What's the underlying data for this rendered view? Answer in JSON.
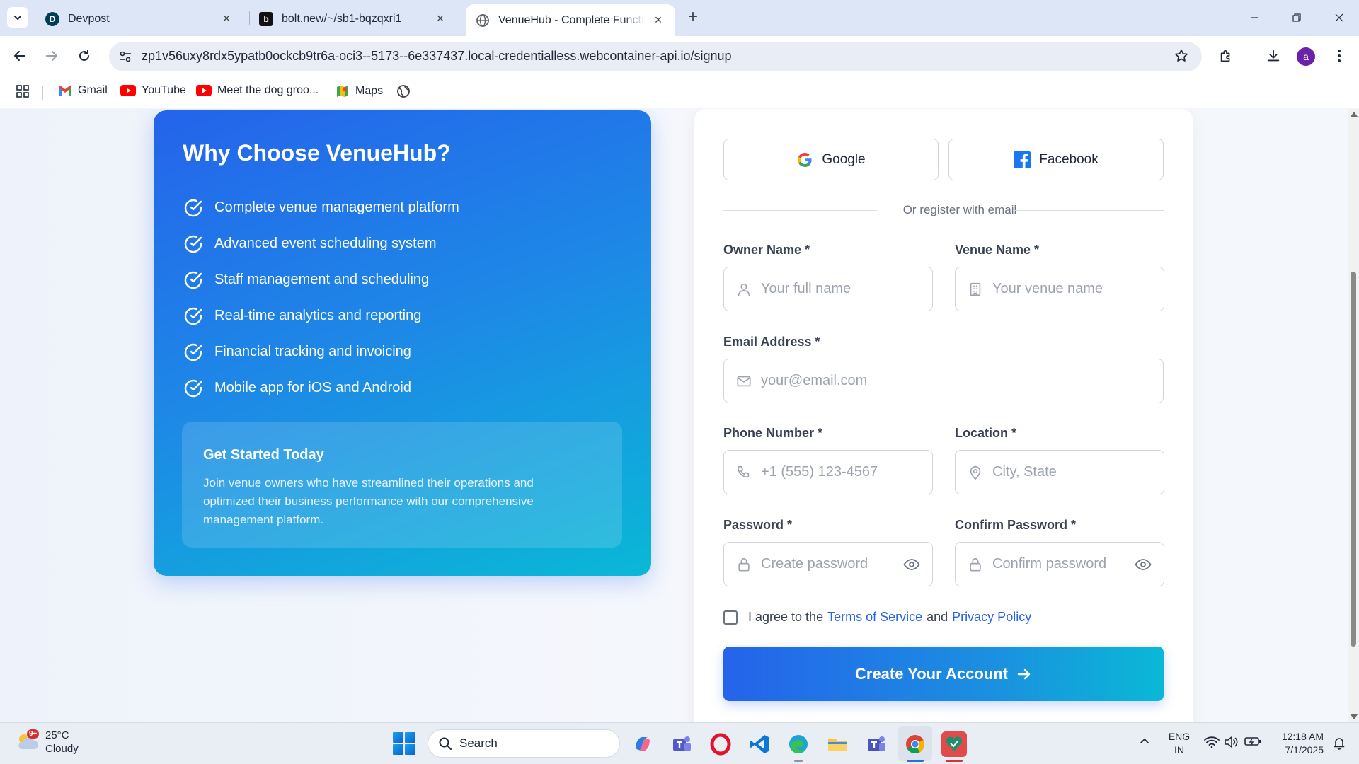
{
  "browser": {
    "tabs": [
      {
        "title": "Devpost",
        "icon": "devpost-icon",
        "favicon_letter": "D",
        "active": false
      },
      {
        "title": "bolt.new/~/sb1-bqzqxri1",
        "icon": "bolt-icon",
        "favicon_letter": "b",
        "active": false
      },
      {
        "title": "VenueHub - Complete Function",
        "icon": "globe-icon",
        "active": true
      }
    ],
    "url": "zp1v56uxy8rdx5ypatb0ockcb9tr6a-oci3--5173--6e337437.local-credentialless.webcontainer-api.io/signup",
    "profile_initial": "a",
    "bookmarks": [
      {
        "label": "Gmail",
        "icon": "gmail-icon"
      },
      {
        "label": "YouTube",
        "icon": "youtube-icon"
      },
      {
        "label": "Meet the dog groo...",
        "icon": "youtube-icon"
      },
      {
        "label": "Maps",
        "icon": "maps-icon"
      }
    ]
  },
  "hero": {
    "title": "Why Choose VenueHub?",
    "features": [
      "Complete venue management platform",
      "Advanced event scheduling system",
      "Staff management and scheduling",
      "Real-time analytics and reporting",
      "Financial tracking and invoicing",
      "Mobile app for iOS and Android"
    ],
    "cta_title": "Get Started Today",
    "cta_text": "Join venue owners who have streamlined their operations and optimized their business performance with our comprehensive management platform."
  },
  "form": {
    "google_label": "Google",
    "facebook_label": "Facebook",
    "divider_text": "Or register with email",
    "owner_name": {
      "label": "Owner Name *",
      "placeholder": "Your full name",
      "value": ""
    },
    "venue_name": {
      "label": "Venue Name *",
      "placeholder": "Your venue name",
      "value": ""
    },
    "email": {
      "label": "Email Address *",
      "placeholder": "your@email.com",
      "value": ""
    },
    "phone": {
      "label": "Phone Number *",
      "placeholder": "+1 (555) 123-4567",
      "value": ""
    },
    "location": {
      "label": "Location *",
      "placeholder": "City, State",
      "value": ""
    },
    "password": {
      "label": "Password *",
      "placeholder": "Create password",
      "value": ""
    },
    "confirm_password": {
      "label": "Confirm Password *",
      "placeholder": "Confirm password",
      "value": ""
    },
    "agree_prefix": "I agree to the",
    "terms_label": "Terms of Service",
    "agree_and": "and",
    "privacy_label": "Privacy Policy",
    "agree_checked": false,
    "submit_label": "Create Your Account"
  },
  "taskbar": {
    "weather_temp": "25°C",
    "weather_desc": "Cloudy",
    "weather_badge": "9+",
    "search_label": "Search",
    "lang_line1": "ENG",
    "lang_line2": "IN",
    "time": "12:18 AM",
    "date": "7/1/2025"
  },
  "colors": {
    "brand_blue": "#2563eb",
    "brand_cyan": "#0ab8d6",
    "link": "#2563eb"
  }
}
